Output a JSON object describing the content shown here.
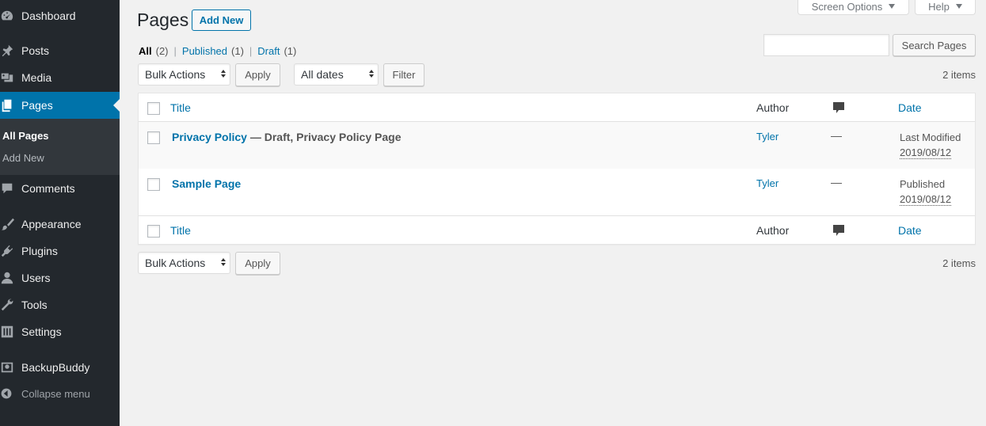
{
  "sidebar": {
    "items": [
      {
        "label": "Dashboard",
        "icon": "dashboard-icon"
      },
      {
        "label": "Posts",
        "icon": "pin-icon"
      },
      {
        "label": "Media",
        "icon": "media-icon"
      },
      {
        "label": "Pages",
        "icon": "pages-icon"
      },
      {
        "label": "Comments",
        "icon": "comment-icon"
      },
      {
        "label": "Appearance",
        "icon": "brush-icon"
      },
      {
        "label": "Plugins",
        "icon": "plug-icon"
      },
      {
        "label": "Users",
        "icon": "user-icon"
      },
      {
        "label": "Tools",
        "icon": "wrench-icon"
      },
      {
        "label": "Settings",
        "icon": "settings-icon"
      },
      {
        "label": "BackupBuddy",
        "icon": "backup-icon"
      }
    ],
    "submenu": [
      "All Pages",
      "Add New"
    ],
    "collapse_label": "Collapse menu"
  },
  "header": {
    "title": "Pages",
    "add_new": "Add New",
    "screen_options": "Screen Options",
    "help": "Help"
  },
  "filters": {
    "all": "All",
    "all_count": "(2)",
    "published": "Published",
    "published_count": "(1)",
    "draft": "Draft",
    "draft_count": "(1)",
    "sep": "|"
  },
  "toolbar": {
    "bulk_actions": "Bulk Actions",
    "apply": "Apply",
    "all_dates": "All dates",
    "filter": "Filter",
    "search_button": "Search Pages",
    "search_value": "",
    "items_count": "2 items"
  },
  "table": {
    "headers": {
      "title": "Title",
      "author": "Author",
      "date": "Date"
    },
    "rows": [
      {
        "title": "Privacy Policy",
        "state": " — Draft, Privacy Policy Page",
        "author": "Tyler",
        "comments": "—",
        "date_status": "Last Modified",
        "date": "2019/08/12"
      },
      {
        "title": "Sample Page",
        "state": "",
        "author": "Tyler",
        "comments": "—",
        "date_status": "Published",
        "date": "2019/08/12"
      }
    ]
  },
  "colors": {
    "sidebar": "#23282d",
    "active": "#0073aa",
    "link": "#0073aa"
  }
}
